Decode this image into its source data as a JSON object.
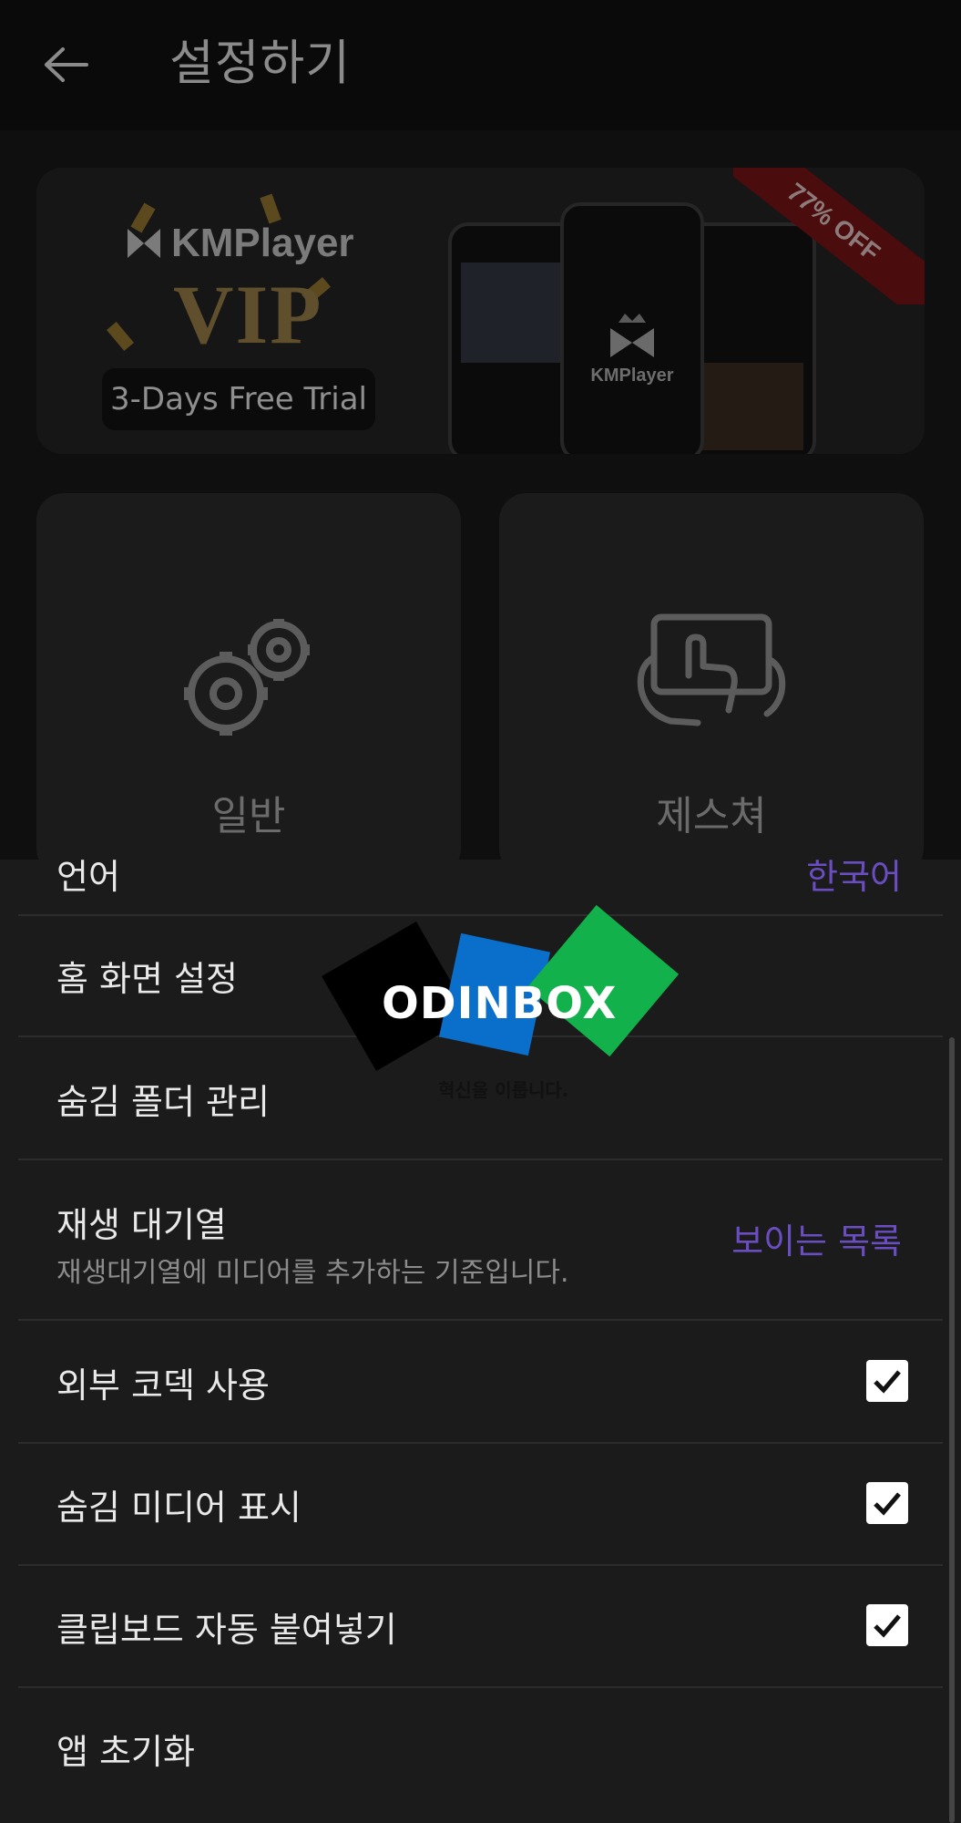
{
  "app_bar": {
    "title": "설정하기",
    "back_icon": "arrow-left-icon"
  },
  "banner": {
    "brand": "KMPlayer",
    "vip": "VIP",
    "trial_label": "3-Days Free Trial",
    "ribbon": "77% OFF",
    "phone_logo": "KMPlayer"
  },
  "categories": [
    {
      "label": "일반",
      "icon": "gears-icon"
    },
    {
      "label": "제스쳐",
      "icon": "hand-gesture-icon"
    }
  ],
  "settings": {
    "partial_row": {
      "label": "언어",
      "value": "한국어"
    },
    "items": [
      {
        "label": "홈 화면 설정"
      },
      {
        "label": "숨김 폴더 관리"
      },
      {
        "label": "재생 대기열",
        "description": "재생대기열에 미디어를 추가하는 기준입니다.",
        "value": "보이는 목록"
      },
      {
        "label": "외부 코덱 사용",
        "checked": true
      },
      {
        "label": "숨김 미디어 표시",
        "checked": true
      },
      {
        "label": "클립보드 자동 붙여넣기",
        "checked": true
      },
      {
        "label": "앱 초기화"
      }
    ]
  },
  "watermark": {
    "text": "ODINBOX",
    "slogan": "혁신을 이룹니다."
  },
  "colors": {
    "accent": "#6a4dc0",
    "background": "#1b1b1b",
    "appbar": "#0a0a0a"
  }
}
